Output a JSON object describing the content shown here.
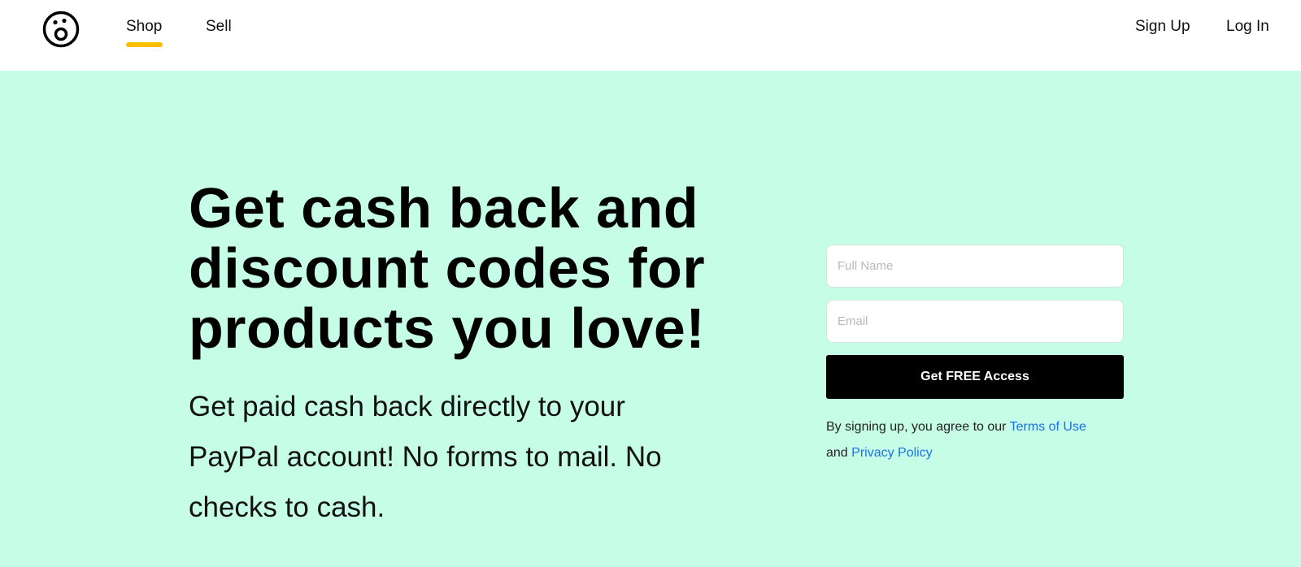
{
  "theme": {
    "hero_bg": "#c6fde6",
    "accent": "#ffbf00",
    "link": "#1a73e8"
  },
  "nav": {
    "logo_icon": "surprised-face-logo-icon",
    "shop": "Shop",
    "sell": "Sell",
    "sign_up": "Sign Up",
    "log_in": "Log In"
  },
  "hero": {
    "headline_lines": [
      "Get cash back and",
      "discount codes for",
      "products you love!"
    ],
    "subline_lines": [
      "Get paid cash back directly to your",
      "PayPal account! No forms to mail. No",
      "checks to cash."
    ]
  },
  "form": {
    "full_name_placeholder": "Full Name",
    "email_placeholder": "Email",
    "submit_label": "Get FREE Access",
    "legal_prefix": "By signing up, you agree to our ",
    "terms_label": "Terms of Use",
    "legal_and": "and ",
    "privacy_label": "Privacy Policy"
  }
}
